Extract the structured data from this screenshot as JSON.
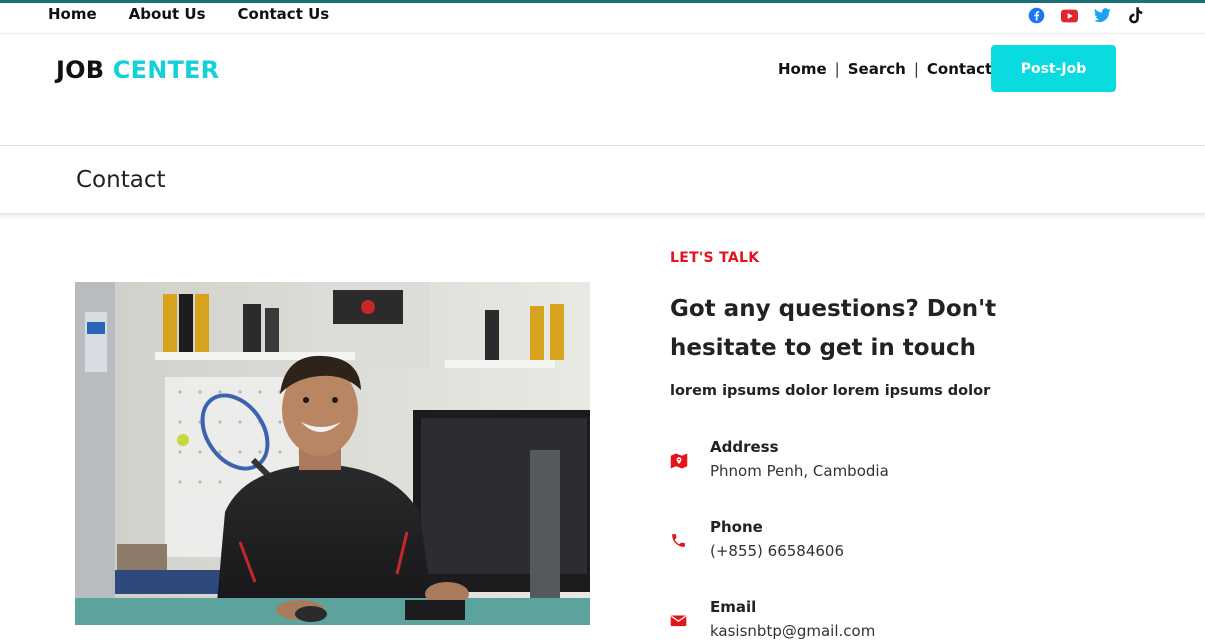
{
  "topbar": {
    "links": [
      "Home",
      "About Us",
      "Contact Us"
    ],
    "social": [
      {
        "icon": "facebook-icon",
        "color": "#1877f2"
      },
      {
        "icon": "youtube-icon",
        "color": "#e0262f"
      },
      {
        "icon": "twitter-icon",
        "color": "#1da1f2"
      },
      {
        "icon": "tiktok-icon",
        "color": "#111111"
      }
    ]
  },
  "brand": {
    "part1": "JOB",
    "part2": "CENTER",
    "accent": "#14d0d8"
  },
  "nav": {
    "items": [
      "Home",
      "Search",
      "Contact"
    ],
    "separator": "|",
    "post_button": "Post-Job"
  },
  "page": {
    "title": "Contact"
  },
  "contact": {
    "kicker": "LET'S TALK",
    "headline": "Got any questions? Don't hesitate to get in touch",
    "lead": "lorem ipsums dolor lorem ipsums dolor",
    "accent": "#e3141c",
    "items": [
      {
        "icon": "map-icon",
        "label": "Address",
        "value": "Phnom Penh, Cambodia"
      },
      {
        "icon": "phone-icon",
        "label": "Phone",
        "value": "(+855) 66584606"
      },
      {
        "icon": "envelope-icon",
        "label": "Email",
        "value": "kasisnbtp@gmail.com"
      }
    ]
  }
}
